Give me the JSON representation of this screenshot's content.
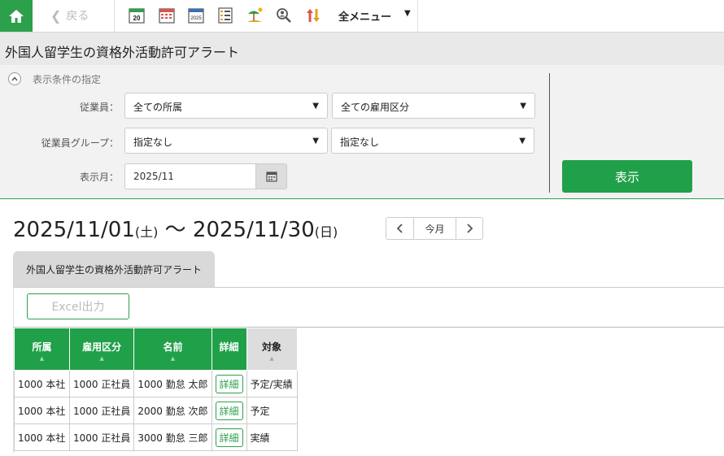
{
  "nav": {
    "back_label": "戻る",
    "all_menu_label": "全メニュー"
  },
  "page": {
    "title": "外国人留学生の資格外活動許可アラート"
  },
  "filter": {
    "heading": "表示条件の指定",
    "employee_label": "従業員：",
    "employee_affiliation": "全ての所属",
    "employee_type": "全ての雇用区分",
    "group_label": "従業員グループ：",
    "group_value_1": "指定なし",
    "group_value_2": "指定なし",
    "month_label": "表示月：",
    "month_value": "2025/11",
    "show_button": "表示"
  },
  "range": {
    "start": "2025/11/01",
    "start_day": "(土)",
    "separator": "〜",
    "end": "2025/11/30",
    "end_day": "(日)",
    "today_label": "今月"
  },
  "tab": {
    "label": "外国人留学生の資格外活動許可アラート"
  },
  "toolbar": {
    "excel_label": "Excel出力"
  },
  "table": {
    "headers": {
      "affiliation": "所属",
      "employment_type": "雇用区分",
      "name": "名前",
      "detail": "詳細",
      "target": "対象"
    },
    "detail_label": "詳細",
    "rows": [
      {
        "affiliation": "1000 本社",
        "employment_type": "1000 正社員",
        "name": "1000 勤怠 太郎",
        "target": "予定/実績"
      },
      {
        "affiliation": "1000 本社",
        "employment_type": "1000 正社員",
        "name": "2000 勤怠 次郎",
        "target": "予定"
      },
      {
        "affiliation": "1000 本社",
        "employment_type": "1000 正社員",
        "name": "3000 勤怠 三郎",
        "target": "実績"
      }
    ]
  },
  "colors": {
    "accent": "#21a04a",
    "panel": "#f2f2f2",
    "title_bar": "#e9e9e9"
  },
  "icons": [
    "home-icon",
    "chevron-left-icon",
    "calendar-20-icon",
    "calendar-grid-icon",
    "calendar-2025-icon",
    "list-icon",
    "vacation-icon",
    "search-person-icon",
    "sort-arrows-icon",
    "chevron-down-icon",
    "collapse-up-icon",
    "calendar-icon",
    "chevron-right-icon",
    "sort-icon"
  ]
}
